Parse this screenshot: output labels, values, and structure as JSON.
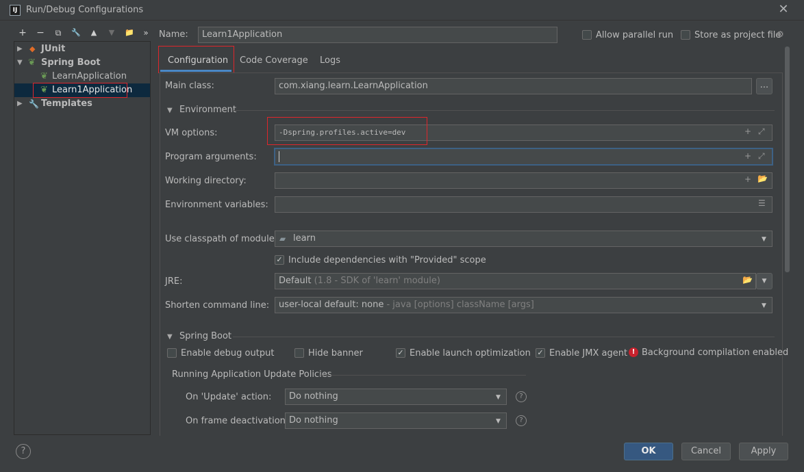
{
  "window": {
    "title": "Run/Debug Configurations",
    "app_icon": "IJ",
    "close": "✕"
  },
  "toolbar": {
    "add": "+",
    "remove": "−",
    "copy": "⧉",
    "edit": "🔧",
    "up": "▲",
    "down": "▼",
    "folder": "📁",
    "more": "»"
  },
  "tree": {
    "junit": "JUnit",
    "spring_boot": "Spring Boot",
    "learn_app": "LearnApplication",
    "learn1_app": "Learn1Application",
    "templates": "Templates"
  },
  "header": {
    "name_label": "Name:",
    "name_value": "Learn1Application",
    "parallel_label": "Allow parallel run",
    "store_label": "Store as project file"
  },
  "tabs": {
    "configuration": "Configuration",
    "coverage": "Code Coverage",
    "logs": "Logs"
  },
  "form": {
    "main_class_label": "Main class:",
    "main_class_value": "com.xiang.learn.LearnApplication",
    "main_class_browse": "...",
    "environment_section": "Environment",
    "vm_label": "VM options:",
    "vm_value": "-Dspring.profiles.active=dev",
    "program_args_label": "Program arguments:",
    "working_dir_label": "Working directory:",
    "env_vars_label": "Environment variables:",
    "classpath_label": "Use classpath of module:",
    "classpath_value": "learn",
    "include_deps_label": "Include dependencies with \"Provided\" scope",
    "jre_label": "JRE:",
    "jre_value": "Default",
    "jre_hint": "(1.8 - SDK of 'learn' module)",
    "shorten_label": "Shorten command line:",
    "shorten_value": "user-local default: none",
    "shorten_hint": "- java [options] className [args]",
    "spring_boot_section": "Spring Boot",
    "enable_debug_label": "Enable debug output",
    "hide_banner_label": "Hide banner",
    "launch_opt_label": "Enable launch optimization",
    "jmx_label": "Enable JMX agent",
    "bg_compile_label": "Background compilation enabled",
    "policies_section": "Running Application Update Policies",
    "update_action_label": "On 'Update' action:",
    "update_action_value": "Do nothing",
    "frame_deact_label": "On frame deactivation:",
    "frame_deact_value": "Do nothing"
  },
  "footer": {
    "help": "?",
    "ok": "OK",
    "cancel": "Cancel",
    "apply": "Apply"
  },
  "colors": {
    "background": "#3c3f41",
    "selection": "#0d293e",
    "primary_button": "#365880",
    "highlight_box": "#e0262b",
    "error_icon": "#c7222d",
    "junit_icon": "#e06c28",
    "spring_icon": "#6a9955"
  }
}
